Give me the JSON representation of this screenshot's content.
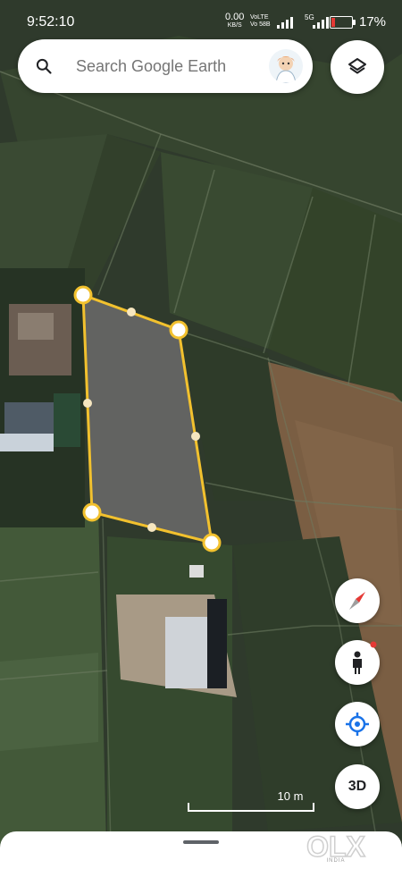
{
  "status_bar": {
    "time": "9:52:10",
    "net_speed_value": "0.00",
    "net_speed_unit": "KB/S",
    "volte_1": "VoLTE",
    "volte_2": "Vo 58B",
    "net_type": "5G",
    "battery_percent": "17%",
    "battery_level": 0.17,
    "battery_color": "#e53935"
  },
  "search": {
    "placeholder": "Search Google Earth"
  },
  "map": {
    "polygon_stroke_color": "#f2c12e",
    "polygon_fill_color": "#6b6b6b",
    "scale_label": "10 m"
  },
  "controls": {
    "layers_icon": "layers-icon",
    "compass_icon": "compass-icon",
    "pegman_icon": "pegman-icon",
    "locate_icon": "my-location-icon",
    "three_d_label": "3D",
    "accent_color": "#1a73e8"
  },
  "watermark": {
    "text": "OLX",
    "subtext": "INDIA"
  }
}
